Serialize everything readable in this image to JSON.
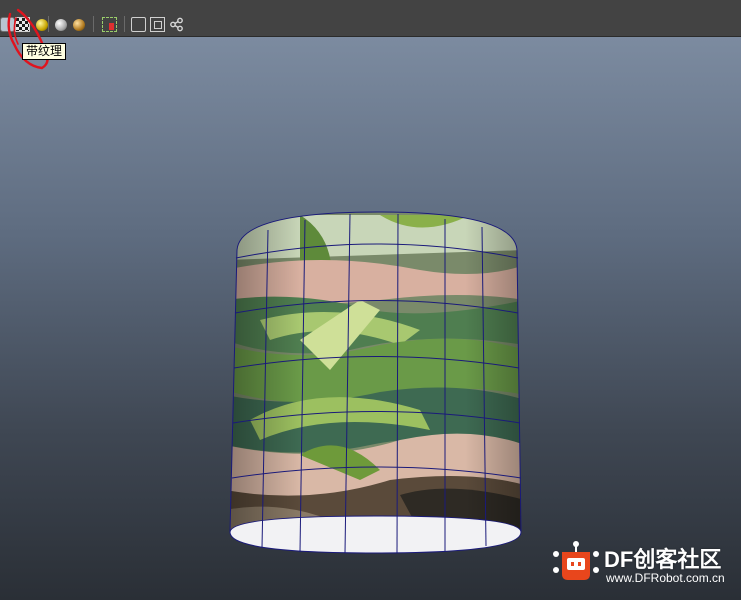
{
  "toolbar": {
    "buttons": [
      "wireframe-shaded",
      "textured",
      "default-light",
      "all-lights",
      "specular-light",
      "isolate-select",
      "bounding-box",
      "xray",
      "node-graph"
    ],
    "tooltip": "带纹理"
  },
  "watermark": {
    "brand": "DF创客社区",
    "url": "www.DFRobot.com.cn"
  }
}
